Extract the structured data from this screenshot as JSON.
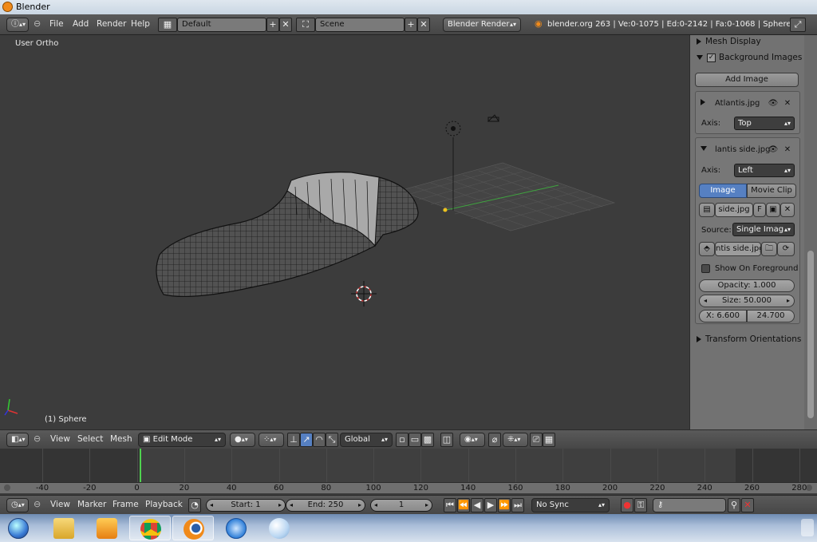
{
  "window": {
    "title": "Blender"
  },
  "infobar": {
    "menus": [
      "File",
      "Add",
      "Render",
      "Help"
    ],
    "layout": "Default",
    "scene": "Scene",
    "engine": "Blender Render",
    "stats": "blender.org 263 | Ve:0-1075 | Ed:0-2142 | Fa:0-1068 | Sphere"
  },
  "viewport": {
    "view_label": "User Ortho",
    "object_label": "(1) Sphere"
  },
  "panel": {
    "mesh_display": "Mesh Display",
    "background_images": "Background Images",
    "add_image": "Add Image",
    "image1": {
      "name": "Atlantis.jpg",
      "axis_label": "Axis:",
      "axis": "Top"
    },
    "image2": {
      "name": "lantis side.jpg",
      "axis_label": "Axis:",
      "axis": "Left",
      "tab_image": "Image",
      "tab_movie": "Movie Clip",
      "file": "side.jpg",
      "f_flag": "F",
      "source_label": "Source:",
      "source": "Single Imag",
      "filepath": "ntis side.jpg",
      "show_foreground": "Show On Foreground",
      "opacity": "Opacity: 1.000",
      "size": "Size: 50.000",
      "x": "X: 6.600",
      "y": "24.700"
    },
    "transform_orientations": "Transform Orientations"
  },
  "view_header": {
    "menus": [
      "View",
      "Select",
      "Mesh"
    ],
    "mode": "Edit Mode",
    "orientation": "Global"
  },
  "timeline": {
    "ticks": [
      "-40",
      "-20",
      "0",
      "20",
      "40",
      "60",
      "80",
      "100",
      "120",
      "140",
      "160",
      "180",
      "200",
      "220",
      "240",
      "260",
      "280"
    ],
    "current_frame_value": 0
  },
  "timeline_header": {
    "menus": [
      "View",
      "Marker",
      "Frame",
      "Playback"
    ],
    "start": "Start: 1",
    "end": "End: 250",
    "current": "1",
    "sync": "No Sync"
  },
  "colors": {
    "active_tab": "#5680c2",
    "accent_orange": "#f08a1a",
    "frame_line": "#4fd34f"
  }
}
